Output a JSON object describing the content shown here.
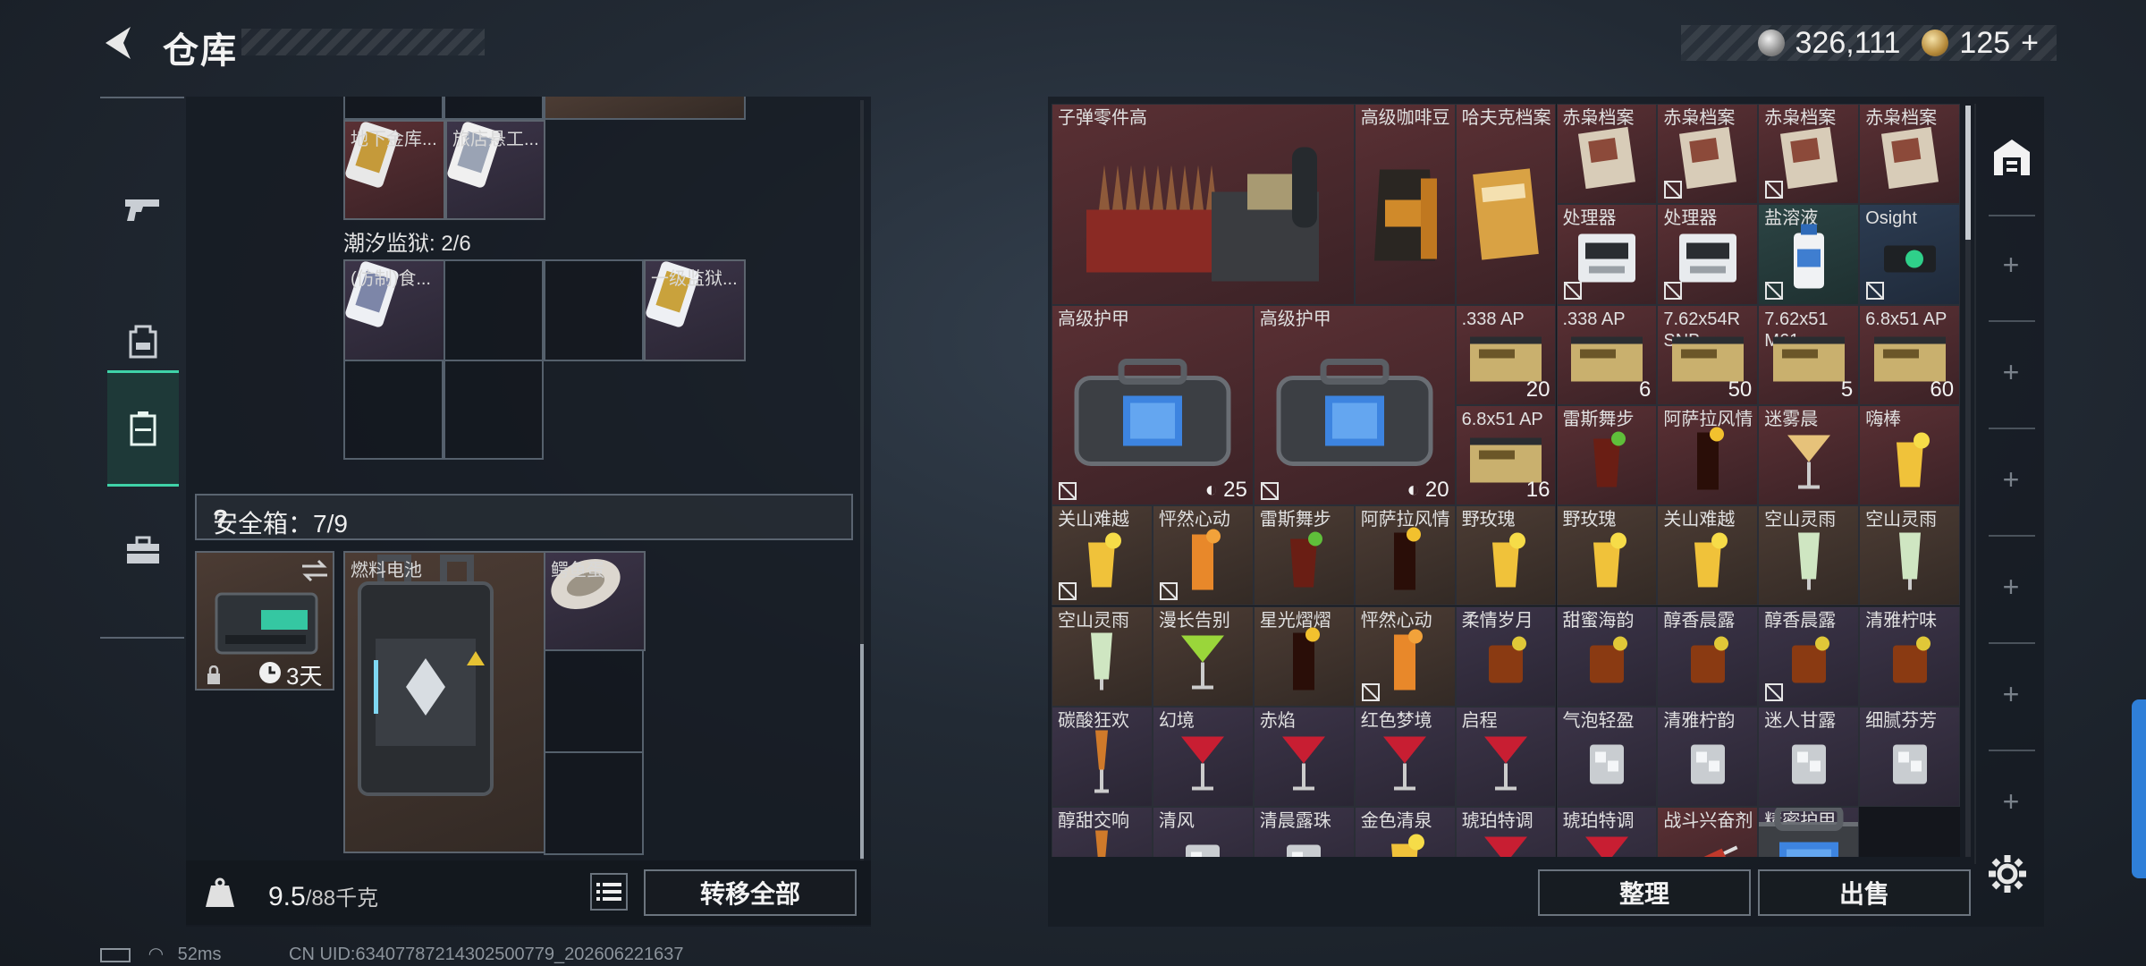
{
  "header": {
    "title": "仓库",
    "silver": "326,111",
    "gold": "125",
    "gold_plus": "+"
  },
  "left": {
    "top_items": [
      {
        "name": "地下金库..."
      },
      {
        "name": "旅店悬工..."
      }
    ],
    "prison_label": "潮汐监狱: 2/6",
    "prison_items": [
      {
        "name": "(仿制)食..."
      },
      {
        "name": "一级监狱..."
      }
    ],
    "safe_label": "安全箱：7/9",
    "safe_qmark": "?",
    "safe_timer": "3天",
    "fuel_name": "燃料电池",
    "egg_name": "鳄鱼蛋",
    "weight_value": "9.5",
    "weight_max": "/88千克",
    "transfer_all": "转移全部"
  },
  "stash": {
    "sort": "整理",
    "sell": "出售",
    "items": [
      {
        "name": "子弹零件高",
        "count": ""
      },
      {
        "name": "高级咖啡豆",
        "count": ""
      },
      {
        "name": "哈夫克档案",
        "count": ""
      },
      {
        "name": "赤枭档案",
        "count": ""
      },
      {
        "name": "赤枭档案",
        "count": ""
      },
      {
        "name": "赤枭档案",
        "count": ""
      },
      {
        "name": "赤枭档案",
        "count": ""
      },
      {
        "name": "处理器",
        "count": ""
      },
      {
        "name": "处理器",
        "count": ""
      },
      {
        "name": "盐溶液",
        "count": ""
      },
      {
        "name": "Osight",
        "count": ""
      },
      {
        "name": "高级护甲",
        "count": "25"
      },
      {
        "name": "高级护甲",
        "count": "20"
      },
      {
        "name": ".338 AP",
        "count": "20"
      },
      {
        "name": ".338 AP",
        "count": "6"
      },
      {
        "name": "7.62x54R SNB",
        "count": "50"
      },
      {
        "name": "7.62x51 M61",
        "count": "5"
      },
      {
        "name": "6.8x51 AP",
        "count": "60"
      },
      {
        "name": "6.8x51 AP",
        "count": "16"
      },
      {
        "name": "雷斯舞步",
        "count": ""
      },
      {
        "name": "阿萨拉风情",
        "count": ""
      },
      {
        "name": "迷雾晨",
        "count": ""
      },
      {
        "name": "嗨棒",
        "count": ""
      },
      {
        "name": "关山难越",
        "count": ""
      },
      {
        "name": "怦然心动",
        "count": ""
      },
      {
        "name": "雷斯舞步",
        "count": ""
      },
      {
        "name": "阿萨拉风情",
        "count": ""
      },
      {
        "name": "野玫瑰",
        "count": ""
      },
      {
        "name": "野玫瑰",
        "count": ""
      },
      {
        "name": "关山难越",
        "count": ""
      },
      {
        "name": "空山灵雨",
        "count": ""
      },
      {
        "name": "空山灵雨",
        "count": ""
      },
      {
        "name": "空山灵雨",
        "count": ""
      },
      {
        "name": "漫长告别",
        "count": ""
      },
      {
        "name": "星光熠熠",
        "count": ""
      },
      {
        "name": "怦然心动",
        "count": ""
      },
      {
        "name": "柔情岁月",
        "count": ""
      },
      {
        "name": "甜蜜海韵",
        "count": ""
      },
      {
        "name": "醇香晨露",
        "count": ""
      },
      {
        "name": "醇香晨露",
        "count": ""
      },
      {
        "name": "清雅柠味",
        "count": ""
      },
      {
        "name": "碳酸狂欢",
        "count": ""
      },
      {
        "name": "幻境",
        "count": ""
      },
      {
        "name": "赤焰",
        "count": ""
      },
      {
        "name": "红色梦境",
        "count": ""
      },
      {
        "name": "启程",
        "count": ""
      },
      {
        "name": "气泡轻盈",
        "count": ""
      },
      {
        "name": "清雅柠韵",
        "count": ""
      },
      {
        "name": "迷人甘露",
        "count": ""
      },
      {
        "name": "细腻芬芳",
        "count": ""
      },
      {
        "name": "醇甜交响",
        "count": ""
      },
      {
        "name": "清风",
        "count": ""
      },
      {
        "name": "清晨露珠",
        "count": ""
      },
      {
        "name": "金色清泉",
        "count": ""
      },
      {
        "name": "琥珀特调",
        "count": ""
      },
      {
        "name": "琥珀特调",
        "count": ""
      },
      {
        "name": "战斗兴奋剂",
        "count": ""
      },
      {
        "name": "精密护甲",
        "count": ""
      }
    ]
  },
  "status": {
    "ping": "52ms",
    "uid": "CN UID:634077872143025007​79_202606221637"
  },
  "colors": {
    "accent": "#3fd3a8",
    "handle": "#2f7fd8"
  }
}
